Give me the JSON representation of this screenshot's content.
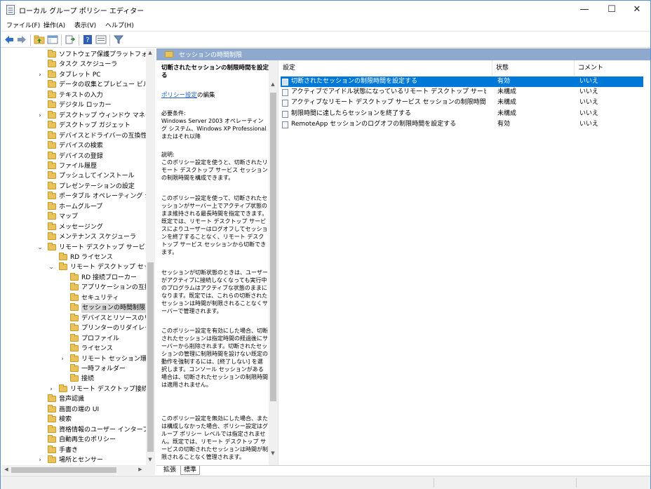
{
  "window": {
    "title": "ローカル グループ ポリシー エディター",
    "minimize": "—",
    "maximize": "☐",
    "close": "✕"
  },
  "menu": [
    "ファイル(F)",
    "操作(A)",
    "表示(V)",
    "ヘルプ(H)"
  ],
  "toolbar_icons": [
    "back-icon",
    "forward-icon",
    "folder-up-icon",
    "show-hide-tree-icon",
    "export-list-icon",
    "help-icon",
    "properties-icon",
    "filter-icon"
  ],
  "tree": [
    {
      "label": "ソフトウェア保護プラットフォーム",
      "indent": 0,
      "exp": ""
    },
    {
      "label": "タスク スケジューラ",
      "indent": 0,
      "exp": ""
    },
    {
      "label": "タブレット PC",
      "indent": 0,
      "exp": ">"
    },
    {
      "label": "データの収集とプレビュー ビルド",
      "indent": 0,
      "exp": ""
    },
    {
      "label": "テキストの入力",
      "indent": 0,
      "exp": ""
    },
    {
      "label": "デジタル ロッカー",
      "indent": 0,
      "exp": ""
    },
    {
      "label": "デスクトップ ウィンドウ マネージャー",
      "indent": 0,
      "exp": ">"
    },
    {
      "label": "デスクトップ ガジェット",
      "indent": 0,
      "exp": ""
    },
    {
      "label": "デバイスとドライバーの互換性",
      "indent": 0,
      "exp": ""
    },
    {
      "label": "デバイスの検索",
      "indent": 0,
      "exp": ""
    },
    {
      "label": "デバイスの登録",
      "indent": 0,
      "exp": ""
    },
    {
      "label": "ファイル履歴",
      "indent": 0,
      "exp": ""
    },
    {
      "label": "プッシュしてインストール",
      "indent": 0,
      "exp": ""
    },
    {
      "label": "プレゼンテーションの設定",
      "indent": 0,
      "exp": ""
    },
    {
      "label": "ポータブル オペレーティング システム",
      "indent": 0,
      "exp": ""
    },
    {
      "label": "ホームグループ",
      "indent": 0,
      "exp": ""
    },
    {
      "label": "マップ",
      "indent": 0,
      "exp": ""
    },
    {
      "label": "メッセージング",
      "indent": 0,
      "exp": ""
    },
    {
      "label": "メンテナンス スケジューラ",
      "indent": 0,
      "exp": ""
    },
    {
      "label": "リモート デスクトップ サービス",
      "indent": 0,
      "exp": "v"
    },
    {
      "label": "RD ライセンス",
      "indent": 1,
      "exp": ""
    },
    {
      "label": "リモート デスクトップ セッション ホスト",
      "indent": 1,
      "exp": "v"
    },
    {
      "label": "RD 接続ブローカー",
      "indent": 2,
      "exp": ""
    },
    {
      "label": "アプリケーションの互換性",
      "indent": 2,
      "exp": ""
    },
    {
      "label": "セキュリティ",
      "indent": 2,
      "exp": ""
    },
    {
      "label": "セッションの時間制限",
      "indent": 2,
      "exp": "",
      "selected": true
    },
    {
      "label": "デバイスとリソースのリダイレクト",
      "indent": 2,
      "exp": ""
    },
    {
      "label": "プリンターのリダイレクト",
      "indent": 2,
      "exp": ""
    },
    {
      "label": "プロファイル",
      "indent": 2,
      "exp": ""
    },
    {
      "label": "ライセンス",
      "indent": 2,
      "exp": ""
    },
    {
      "label": "リモート セッション環境",
      "indent": 2,
      "exp": ">"
    },
    {
      "label": "一時フォルダー",
      "indent": 2,
      "exp": ""
    },
    {
      "label": "接続",
      "indent": 2,
      "exp": ""
    },
    {
      "label": "リモート デスクトップ接続のクライアント",
      "indent": 1,
      "exp": ">"
    },
    {
      "label": "音声認識",
      "indent": 0,
      "exp": ""
    },
    {
      "label": "画面の端の UI",
      "indent": 0,
      "exp": ""
    },
    {
      "label": "検索",
      "indent": 0,
      "exp": ""
    },
    {
      "label": "資格情報のユーザー インターフェイス",
      "indent": 0,
      "exp": ""
    },
    {
      "label": "自動再生のポリシー",
      "indent": 0,
      "exp": ""
    },
    {
      "label": "手書き",
      "indent": 0,
      "exp": ""
    },
    {
      "label": "場所とセンサー",
      "indent": 0,
      "exp": ">"
    }
  ],
  "header": {
    "title": "セッションの時間制限"
  },
  "description": {
    "title": "切断されたセッションの制限時間を設定する",
    "link": "ポリシー設定",
    "link_suffix": "の編集",
    "requirements": "必要条件:\nWindows Server 2003 オペレーティング システム、Windows XP Professional またはそれ以降",
    "p1": "説明:\nこのポリシー設定を使うと、切断されたリモート デスクトップ サービス セッションの制限時間を構成できます。",
    "p2": "このポリシー設定を使って、切断されたセッションがサーバー上でアクティブ状態のまま維持される最長時間を指定できます。既定では、リモート デスクトップ サービスによりユーザーはログオフしてセッションを終了することなく、リモート デスクトップ サービス セッションから切断できます。",
    "p3": "セッションが切断状態のときは、ユーザーがアクティブに接続しなくなっても実行中のプログラムはアクティブな状態のままになります。既定では、これらの切断されたセッションは時間が制限されることなくサーバーで管理されます。",
    "p4": "このポリシー設定を有効にした場合、切断されたセッションは指定時間の経過後にサーバーから削除されます。切断されたセッションの管理に制限時間を設けない既定の動作を強制するには、[終了しない] を選択します。コンソール セッションがある場合は、切断されたセッションの制限時間は適用されません。",
    "p5": "このポリシー設定を無効にした場合、または構成しなかった場合、ポリシー設定はグループ ポリシー レベルでは指定されません。既定では、リモート デスクトップ サービスの切断されたセッションは時間が制限されることなく管理されます。"
  },
  "list": {
    "columns": [
      "設定",
      "状態",
      "コメント"
    ],
    "rows": [
      {
        "name": "切断されたセッションの制限時間を設定する",
        "state": "有効",
        "comment": "いいえ",
        "selected": true
      },
      {
        "name": "アクティブでアイドル状態になっているリモート デスクトップ サービス セッションの制限時間を設定する",
        "state": "未構成",
        "comment": "いいえ"
      },
      {
        "name": "アクティブなリモート デスクトップ サービス セッションの制限時間を設定する",
        "state": "未構成",
        "comment": "いいえ"
      },
      {
        "name": "制限時間に達したらセッションを終了する",
        "state": "未構成",
        "comment": "いいえ"
      },
      {
        "name": "RemoteApp セッションのログオフの制限時間を設定する",
        "state": "有効",
        "comment": "いいえ"
      }
    ]
  },
  "tabs": [
    "拡張",
    "標準"
  ]
}
